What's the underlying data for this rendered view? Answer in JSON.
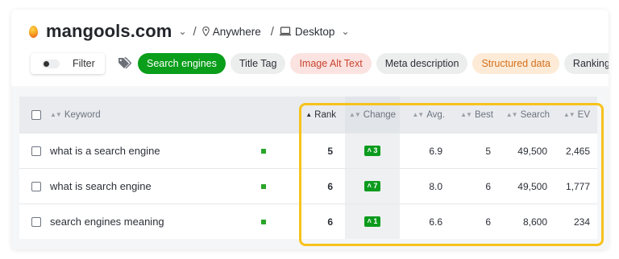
{
  "header": {
    "domain": "mangools.com",
    "location": "Anywhere",
    "device": "Desktop",
    "separator": "/"
  },
  "filters": {
    "toggle_label": "Filter",
    "tags": [
      {
        "label": "Search engines",
        "style": "green"
      },
      {
        "label": "Title Tag",
        "style": "gray"
      },
      {
        "label": "Image Alt Text",
        "style": "red"
      },
      {
        "label": "Meta description",
        "style": "gray"
      },
      {
        "label": "Structured data",
        "style": "orange"
      },
      {
        "label": "Ranking Factors",
        "style": "gray"
      }
    ]
  },
  "table": {
    "columns": {
      "keyword": "Keyword",
      "rank": "Rank",
      "change": "Change",
      "avg": "Avg.",
      "best": "Best",
      "search": "Search",
      "ev": "EV"
    },
    "rows": [
      {
        "keyword": "what is a search engine",
        "rank": "5",
        "change": "3",
        "avg": "6.9",
        "best": "5",
        "search": "49,500",
        "ev": "2,465"
      },
      {
        "keyword": "what is search engine",
        "rank": "6",
        "change": "7",
        "avg": "8.0",
        "best": "6",
        "search": "49,500",
        "ev": "1,777"
      },
      {
        "keyword": "search engines meaning",
        "rank": "6",
        "change": "1",
        "avg": "6.6",
        "best": "6",
        "search": "8,600",
        "ev": "234"
      }
    ]
  },
  "colors": {
    "accent_green": "#0a9e1a",
    "highlight": "#f7c21b"
  },
  "icons": {
    "brand": "mangools-logo-icon",
    "location": "map-pin-icon",
    "device": "monitor-icon",
    "tags": "tags-icon",
    "dropdown": "chevron-down-icon",
    "sort": "sort-icon",
    "up_arrow": "arrow-up-icon"
  }
}
